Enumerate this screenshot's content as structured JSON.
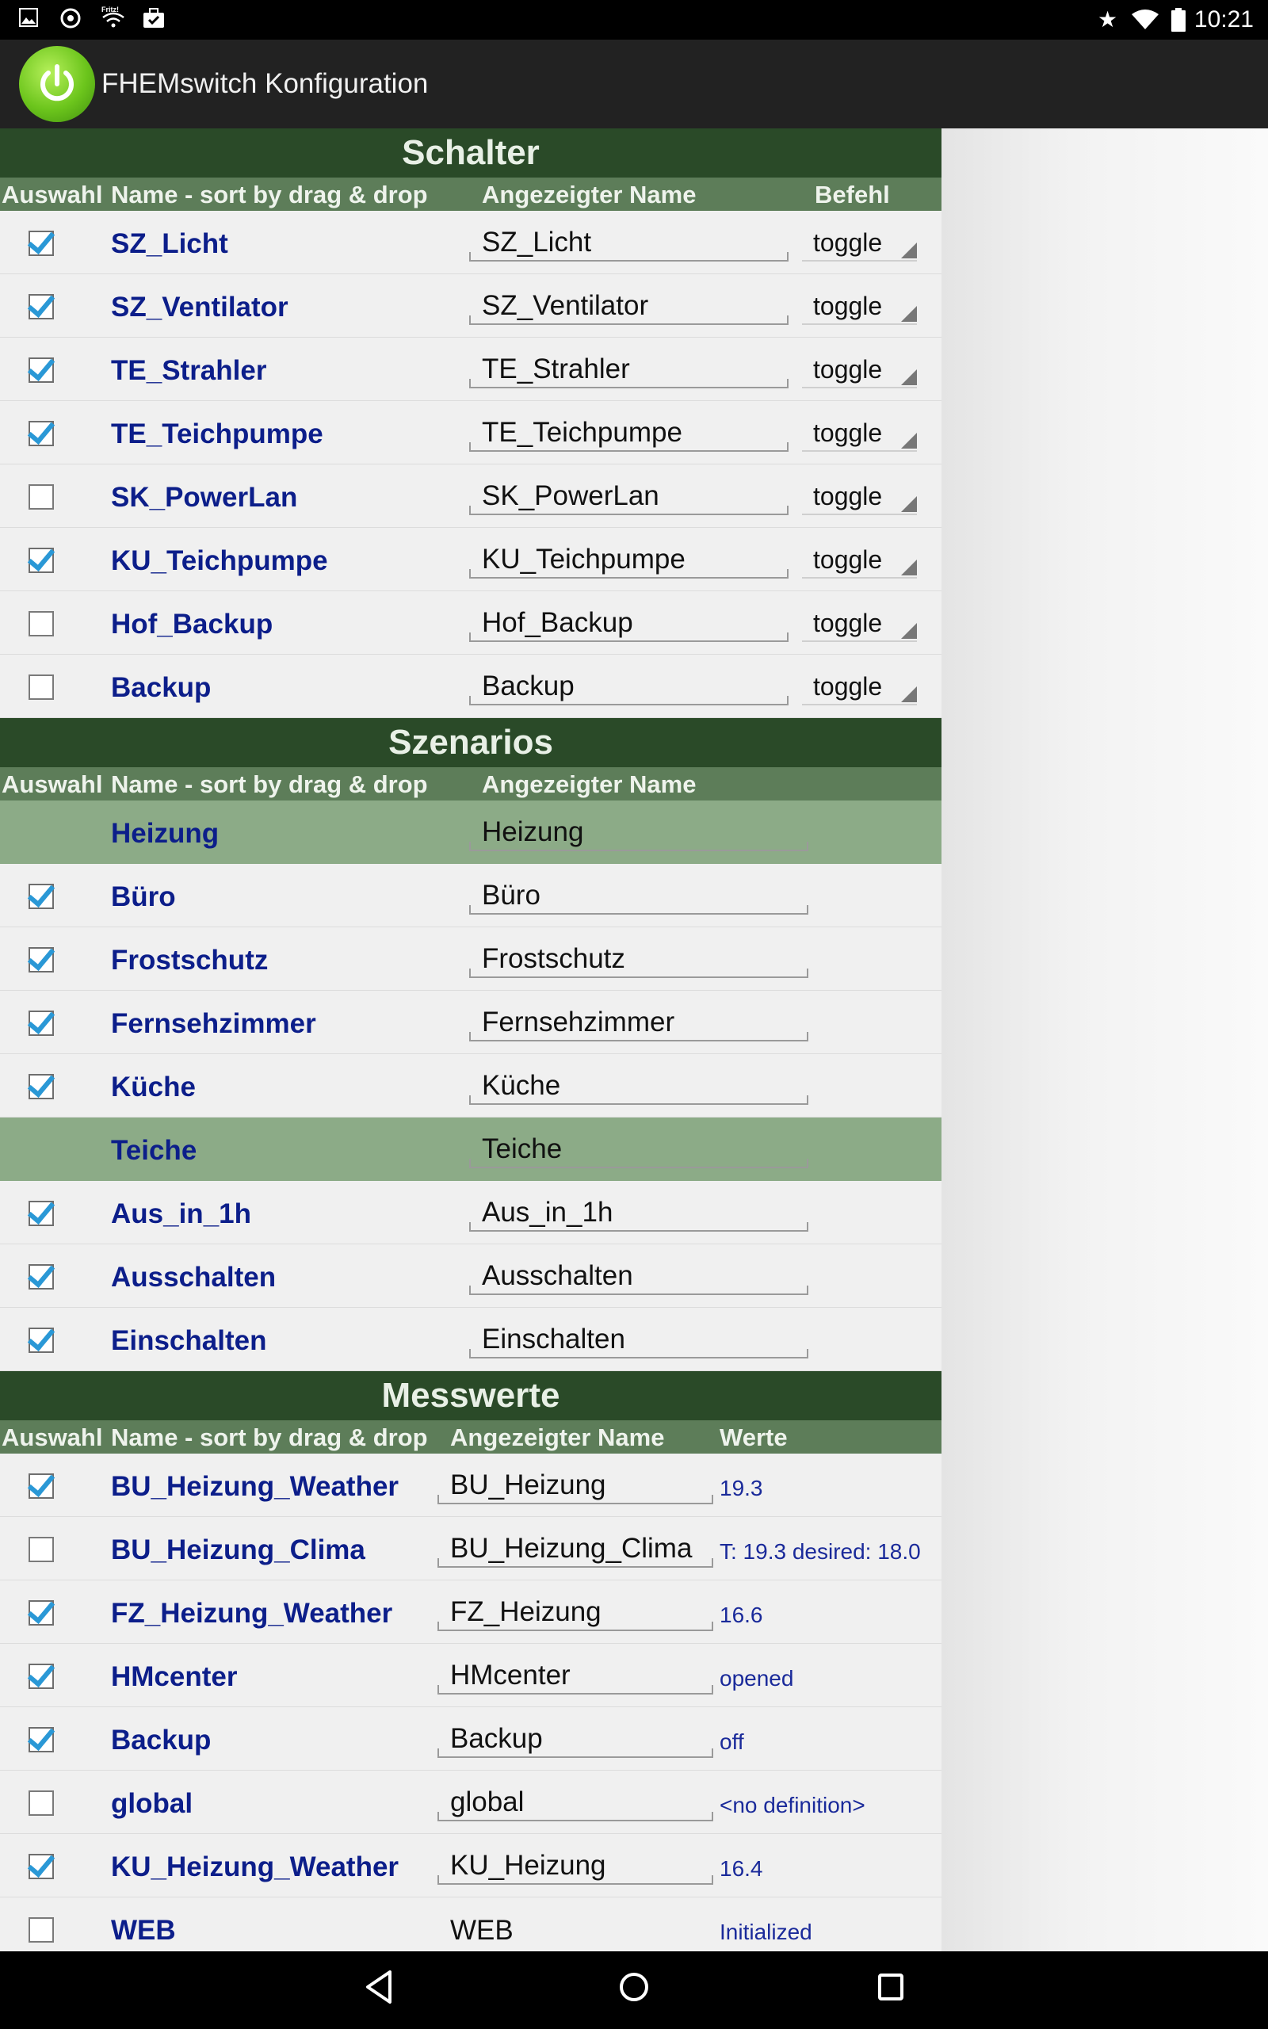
{
  "statusbar": {
    "time": "10:21",
    "left_icons": [
      "image-icon",
      "app-icon",
      "fritz-wifi-icon",
      "briefcase-check-icon"
    ],
    "right_icons": [
      "star-icon",
      "wifi-icon",
      "battery-icon"
    ]
  },
  "actionbar": {
    "title": "FHEMswitch Konfiguration"
  },
  "schalter": {
    "title": "Schalter",
    "headers": {
      "auswahl": "Auswahl",
      "name": "Name - sort by drag & drop",
      "display": "Angezeigter Name",
      "befehl": "Befehl"
    },
    "rows": [
      {
        "checked": true,
        "name": "SZ_Licht",
        "display": "SZ_Licht",
        "befehl": "toggle"
      },
      {
        "checked": true,
        "name": "SZ_Ventilator",
        "display": "SZ_Ventilator",
        "befehl": "toggle"
      },
      {
        "checked": true,
        "name": "TE_Strahler",
        "display": "TE_Strahler",
        "befehl": "toggle"
      },
      {
        "checked": true,
        "name": "TE_Teichpumpe",
        "display": "TE_Teichpumpe",
        "befehl": "toggle"
      },
      {
        "checked": false,
        "name": "SK_PowerLan",
        "display": "SK_PowerLan",
        "befehl": "toggle"
      },
      {
        "checked": true,
        "name": "KU_Teichpumpe",
        "display": "KU_Teichpumpe",
        "befehl": "toggle"
      },
      {
        "checked": false,
        "name": "Hof_Backup",
        "display": "Hof_Backup",
        "befehl": "toggle"
      },
      {
        "checked": false,
        "name": "Backup",
        "display": "Backup",
        "befehl": "toggle"
      }
    ]
  },
  "szenarios": {
    "title": "Szenarios",
    "headers": {
      "auswahl": "Auswahl",
      "name": "Name - sort by drag & drop",
      "display": "Angezeigter Name"
    },
    "rows": [
      {
        "group": true,
        "name": "Heizung",
        "display": "Heizung"
      },
      {
        "checked": true,
        "name": "Büro",
        "display": "Büro"
      },
      {
        "checked": true,
        "name": "Frostschutz",
        "display": "Frostschutz"
      },
      {
        "checked": true,
        "name": "Fernsehzimmer",
        "display": "Fernsehzimmer"
      },
      {
        "checked": true,
        "name": "Küche",
        "display": "Küche"
      },
      {
        "group": true,
        "name": "Teiche",
        "display": "Teiche"
      },
      {
        "checked": true,
        "name": "Aus_in_1h",
        "display": "Aus_in_1h"
      },
      {
        "checked": true,
        "name": "Ausschalten",
        "display": "Ausschalten"
      },
      {
        "checked": true,
        "name": "Einschalten",
        "display": "Einschalten"
      }
    ]
  },
  "messwerte": {
    "title": "Messwerte",
    "headers": {
      "auswahl": "Auswahl",
      "name": "Name - sort by drag & drop",
      "display": "Angezeigter Name",
      "werte": "Werte"
    },
    "rows": [
      {
        "checked": true,
        "name": "BU_Heizung_Weather",
        "display": "BU_Heizung",
        "value": "19.3"
      },
      {
        "checked": false,
        "name": "BU_Heizung_Clima",
        "display": "BU_Heizung_Clima",
        "value": "T: 19.3 desired: 18.0"
      },
      {
        "checked": true,
        "name": "FZ_Heizung_Weather",
        "display": "FZ_Heizung",
        "value": "16.6"
      },
      {
        "checked": true,
        "name": "HMcenter",
        "display": "HMcenter",
        "value": "opened"
      },
      {
        "checked": true,
        "name": "Backup",
        "display": "Backup",
        "value": "off"
      },
      {
        "checked": false,
        "name": "global",
        "display": "global",
        "value": "<no definition>"
      },
      {
        "checked": true,
        "name": "KU_Heizung_Weather",
        "display": "KU_Heizung",
        "value": "16.4"
      },
      {
        "checked": false,
        "name": "WEB",
        "display": "WEB",
        "value": "Initialized",
        "display_plain": true
      }
    ]
  },
  "navbar": {
    "buttons": [
      "back-button",
      "home-button",
      "recents-button"
    ]
  }
}
